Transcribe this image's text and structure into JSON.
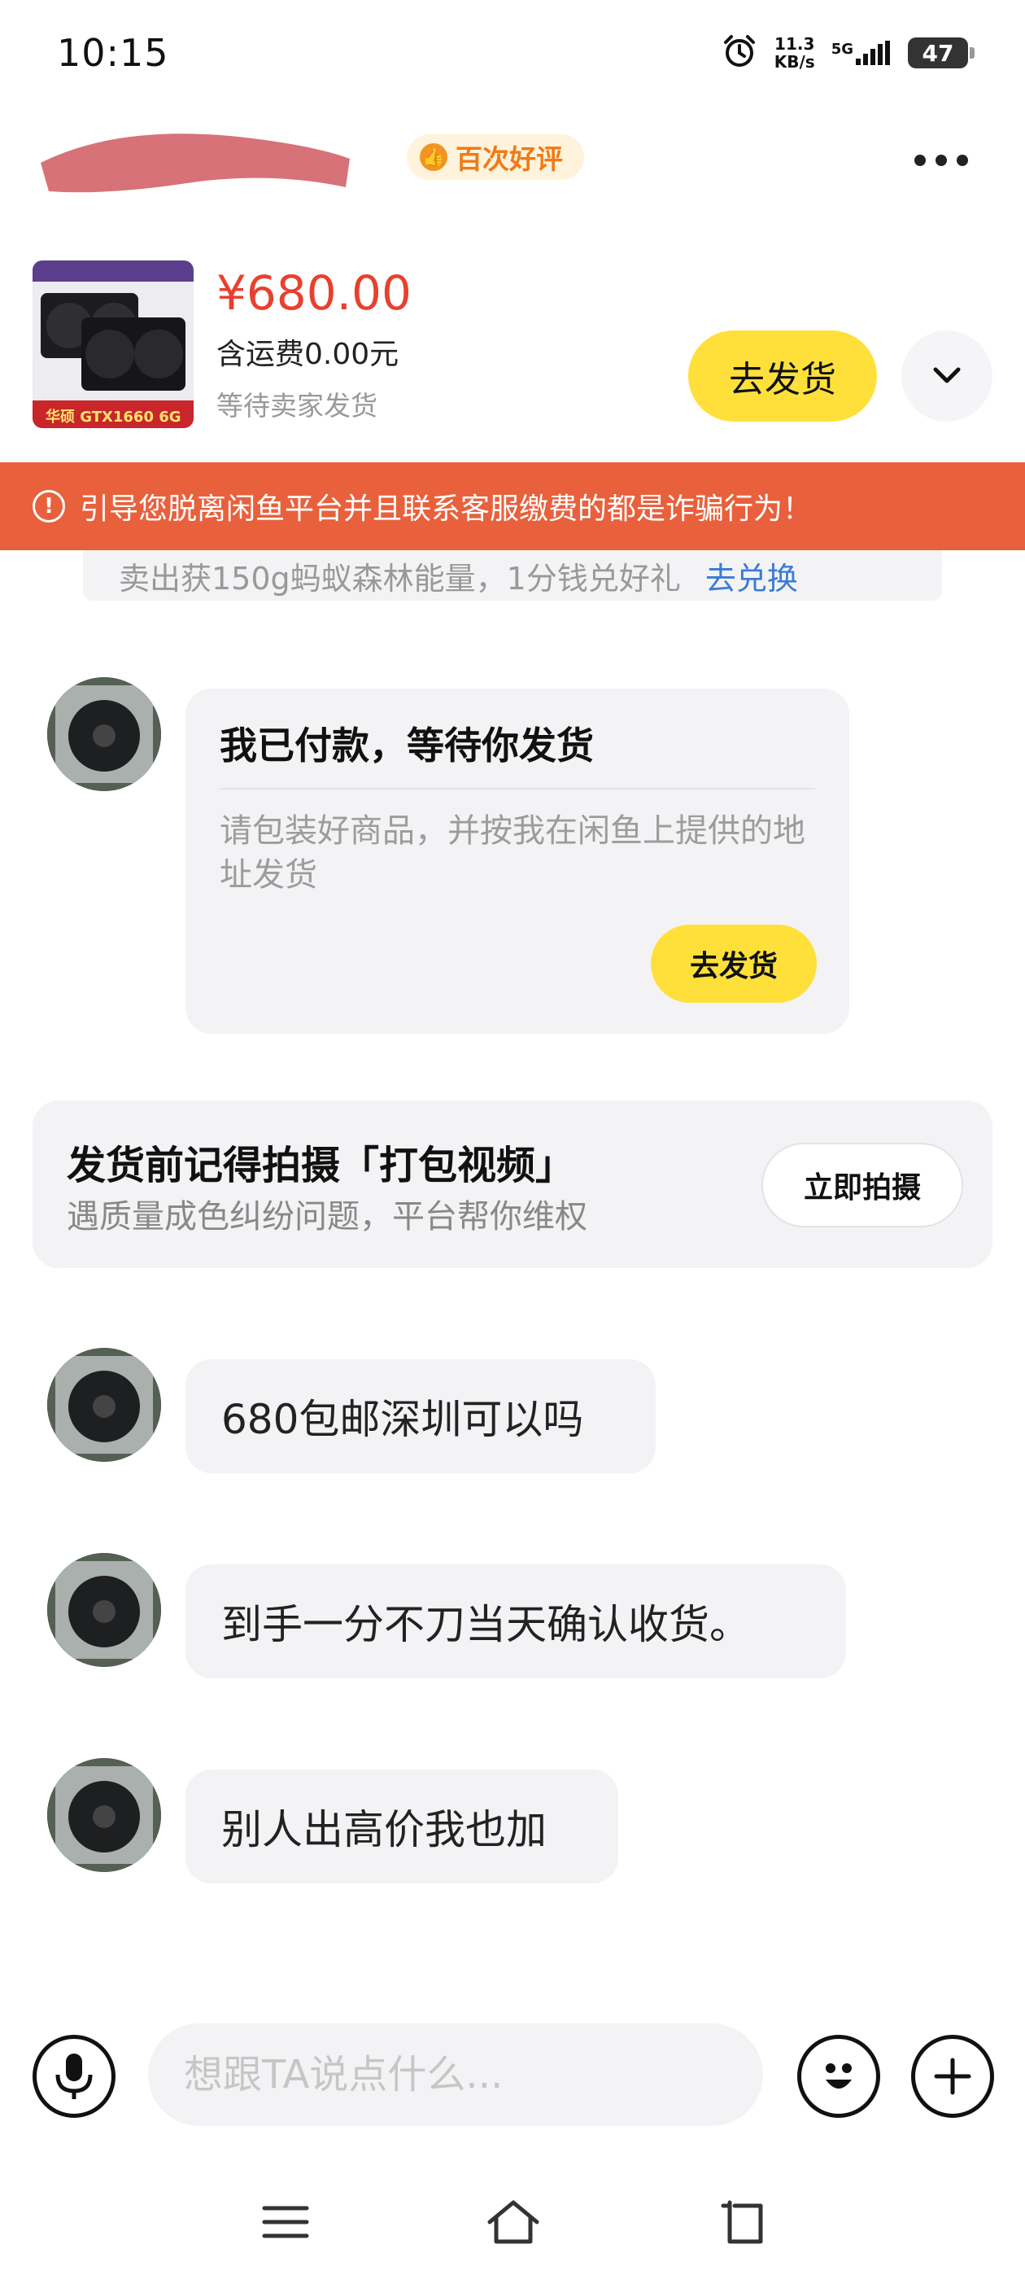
{
  "status_bar": {
    "time": "10:15",
    "net_speed_value": "11.3",
    "net_speed_unit": "KB/s",
    "network": "5G",
    "battery": "47"
  },
  "header": {
    "badge_label": "百次好评",
    "badge_icon": "thumbs-up-icon"
  },
  "product": {
    "image_label": "华硕 GTX1660 6G",
    "price": "¥680.00",
    "shipping_fee": "含运费0.00元",
    "order_status": "等待卖家发货",
    "ship_button": "去发货"
  },
  "warning": {
    "icon": "!",
    "text": "引导您脱离闲鱼平台并且联系客服缴费的都是诈骗行为！"
  },
  "promo": {
    "text": "卖出获150g蚂蚁森林能量，1分钱兑好礼",
    "link": "去兑换"
  },
  "payment_card": {
    "title": "我已付款，等待你发货",
    "description": "请包装好商品，并按我在闲鱼上提供的地址发货",
    "button": "去发货"
  },
  "reminder_card": {
    "title": "发货前记得拍摄「打包视频」",
    "subtitle": "遇质量成色纠纷问题，平台帮你维权",
    "button": "立即拍摄"
  },
  "messages": [
    {
      "text": "680包邮深圳可以吗"
    },
    {
      "text": "到手一分不刀当天确认收货。"
    },
    {
      "text": "别人出高价我也加"
    }
  ],
  "input": {
    "placeholder": "想跟TA说点什么..."
  },
  "colors": {
    "accent_yellow": "#ffe03b",
    "price_red": "#e8402f",
    "warning_orange": "#e8613c",
    "link_blue": "#3b7bd6"
  }
}
